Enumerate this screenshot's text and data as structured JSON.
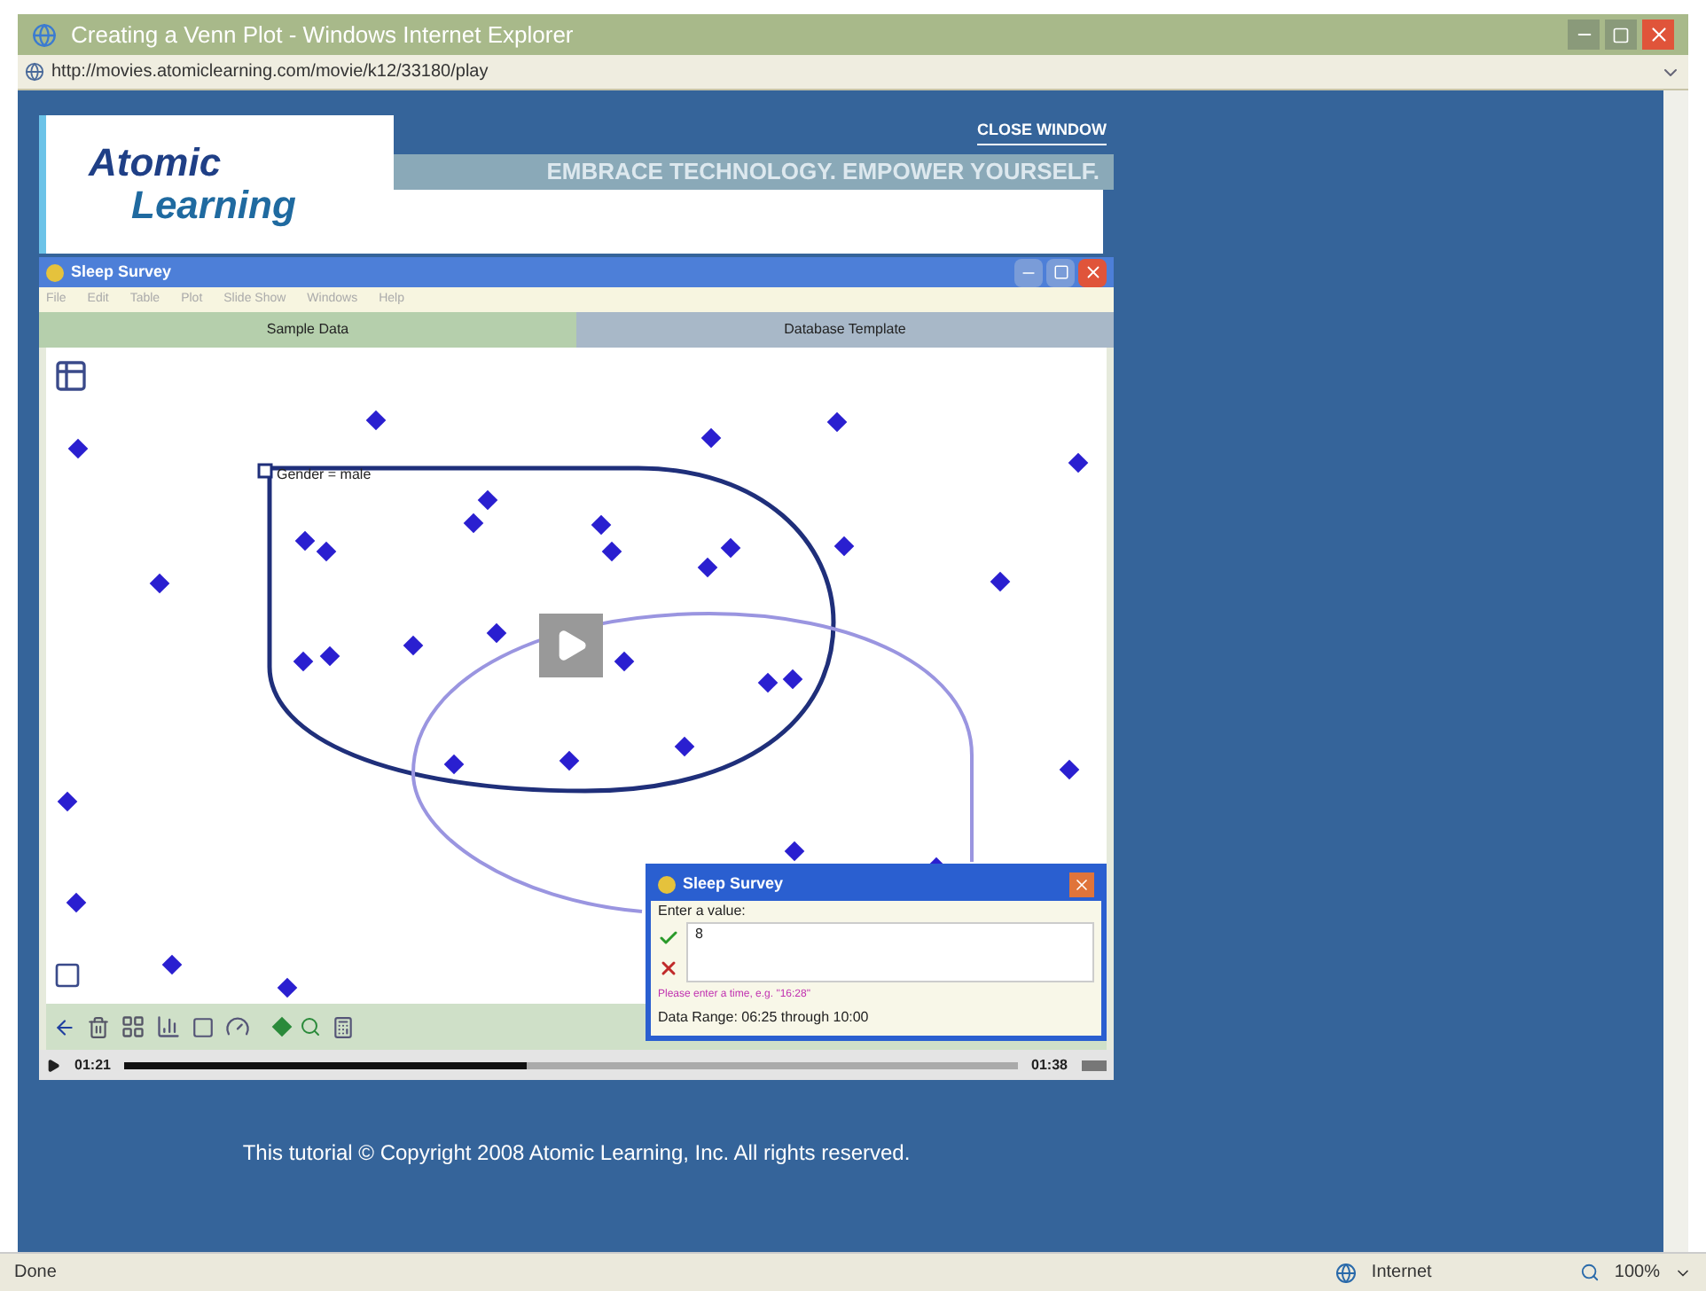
{
  "browser": {
    "title": "Creating a Venn Plot - Windows Internet Explorer",
    "address": "http://movies.atomiclearning.com/movie/k12/33180/play"
  },
  "player": {
    "close_link": "CLOSE WINDOW",
    "logo": [
      "Atomic",
      "Learning"
    ],
    "tagline": "EMBRACE TECHNOLOGY. EMPOWER YOURSELF.",
    "app": {
      "title": "Sleep Survey",
      "menu": [
        "File",
        "Edit",
        "Table",
        "Plot",
        "Slide Show",
        "Windows",
        "Help"
      ],
      "tabs": [
        {
          "label": "Sample Data",
          "selected": true
        },
        {
          "label": "Database Template",
          "selected": false
        }
      ],
      "plot_label": "Gender = male",
      "dialog": {
        "title": "Sleep Survey",
        "prompt": "Enter a value:",
        "value": "8",
        "hint": "Please enter a time, e.g. \"16:28\"",
        "range": "Data Range: 06:25 through 10:00"
      }
    },
    "elapsed": "01:21",
    "total": "01:38",
    "progress": {
      "level": 0.45
    }
  },
  "copyright": "This tutorial © Copyright 2008 Atomic Learning, Inc. All rights reserved.",
  "status_bar": {
    "status": "Done",
    "zone": "Internet",
    "zoom": "100%"
  }
}
